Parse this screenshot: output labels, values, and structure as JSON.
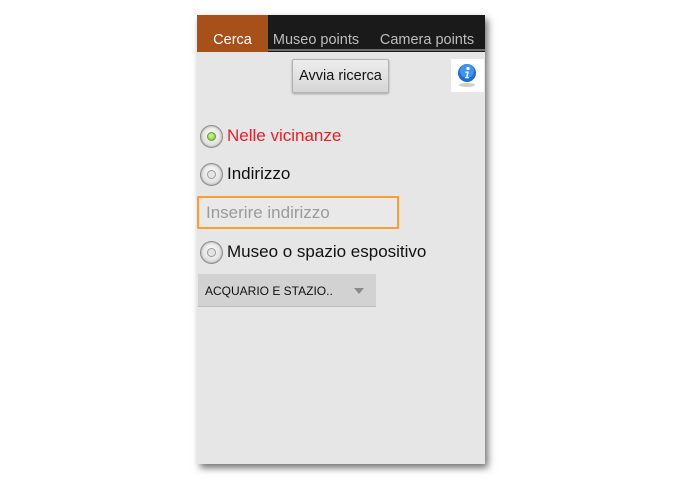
{
  "tabs": [
    {
      "label": "Cerca",
      "active": true
    },
    {
      "label": "Museo points",
      "active": false
    },
    {
      "label": "Camera points",
      "active": false
    }
  ],
  "search_button": "Avvia ricerca",
  "info_icon": "info-icon",
  "options": {
    "nearby": {
      "label": "Nelle vicinanze",
      "selected": true
    },
    "address": {
      "label": "Indirizzo",
      "selected": false
    },
    "museum": {
      "label": "Museo o spazio espositivo",
      "selected": false
    }
  },
  "address_input": {
    "placeholder": "Inserire indirizzo",
    "value": ""
  },
  "museum_select": {
    "value": "ACQUARIO E STAZIO.."
  },
  "colors": {
    "tab_active": "#a8501a",
    "tab_bar": "#1a1a1a",
    "selected_label": "#ee1c24",
    "input_focus": "#ff9c34",
    "background": "#e6e6e6"
  }
}
